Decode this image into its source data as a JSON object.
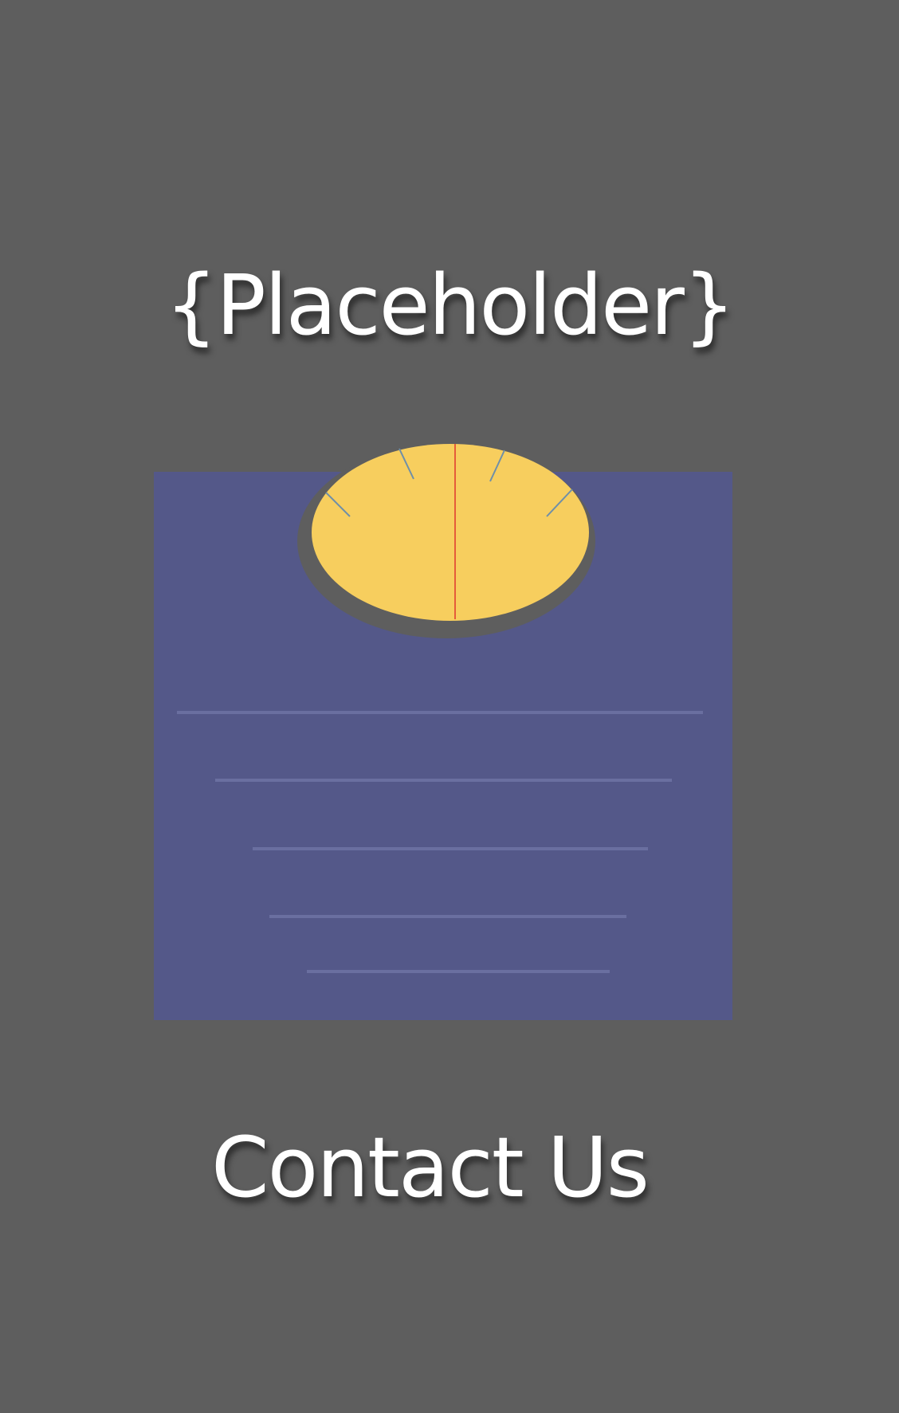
{
  "page": {
    "background_color": "#5e5e5e"
  },
  "header": {
    "title": "{Placeholder}"
  },
  "illustration": {
    "icon": "bathroom-scale-icon",
    "body_color": "#545889",
    "dial_color": "#f7ce5e",
    "needle_color": "#e45c3a",
    "tick_color": "#6f8fa8",
    "line_color": "#6a6fa0"
  },
  "footer": {
    "contact_label": "Contact Us"
  }
}
